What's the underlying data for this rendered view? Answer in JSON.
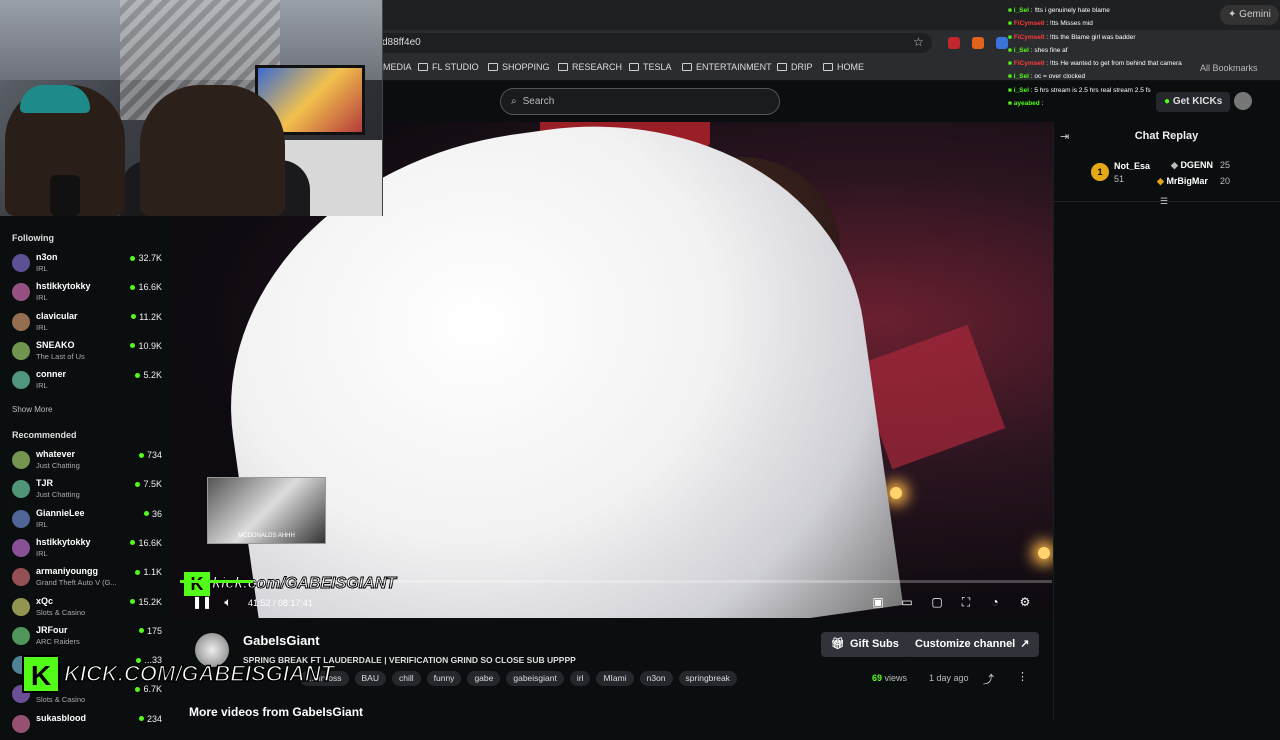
{
  "browser": {
    "url": "d88ff4e0",
    "gemini_label": "Gemini",
    "all_bookmarks_label": "All Bookmarks",
    "bookmarks": [
      "MEDIA",
      "FL STUDIO",
      "SHOPPING",
      "RESEARCH",
      "TESLA",
      "ENTERTAINMENT",
      "DRIP",
      "HOME"
    ]
  },
  "header": {
    "search_placeholder": "Search",
    "get_kicks_label": "Get KICKs"
  },
  "sidebar": {
    "following_heading": "Following",
    "following": [
      {
        "name": "n3on",
        "category": "IRL",
        "viewers": "32.7K"
      },
      {
        "name": "hstikkytokky",
        "category": "IRL",
        "viewers": "16.6K"
      },
      {
        "name": "clavicular",
        "category": "IRL",
        "viewers": "11.2K"
      },
      {
        "name": "SNEAKO",
        "category": "The Last of Us",
        "viewers": "10.9K"
      },
      {
        "name": "conner",
        "category": "IRL",
        "viewers": "5.2K"
      }
    ],
    "show_more": "Show More",
    "recommended_heading": "Recommended",
    "recommended": [
      {
        "name": "whatever",
        "category": "Just Chatting",
        "viewers": "734"
      },
      {
        "name": "TJR",
        "category": "Just Chatting",
        "viewers": "7.5K"
      },
      {
        "name": "GiannieLee",
        "category": "IRL",
        "viewers": "36"
      },
      {
        "name": "hstikkytokky",
        "category": "IRL",
        "viewers": "16.6K"
      },
      {
        "name": "armaniyoungg",
        "category": "Grand Theft Auto V (G...",
        "viewers": "1.1K"
      },
      {
        "name": "xQc",
        "category": "Slots & Casino",
        "viewers": "15.2K"
      },
      {
        "name": "JRFour",
        "category": "ARC Raiders",
        "viewers": "175"
      },
      {
        "name": "...",
        "category": "",
        "viewers": "...33"
      },
      {
        "name": "...ot",
        "category": "Slots & Casino",
        "viewers": "6.7K"
      },
      {
        "name": "sukasblood",
        "category": "",
        "viewers": "234"
      }
    ]
  },
  "chat_overlay": [
    {
      "user": "i_Sel",
      "user_color": "#53fc18",
      "text": ": !tts i genuinely hate blame"
    },
    {
      "user": "FiCymsell",
      "user_color": "#ff3b3b",
      "text": ": !tts Misses mid"
    },
    {
      "user": "FiCymsell",
      "user_color": "#ff3b3b",
      "text": ": !tts the Blame girl was badder"
    },
    {
      "user": "i_Sel",
      "user_color": "#53fc18",
      "text": ": shes fine af"
    },
    {
      "user": "FiCymsell",
      "user_color": "#ff3b3b",
      "text": ": !tts He wanted to get from behind that camera"
    },
    {
      "user": "i_Sel",
      "user_color": "#53fc18",
      "text": ": oc = over clocked"
    },
    {
      "user": "i_Sel",
      "user_color": "#53fc18",
      "text": ": 5 hrs stream is 2.5 hrs real stream 2.5 fs"
    },
    {
      "user": "ayeabed",
      "user_color": "#53fc18",
      "text": ":"
    }
  ],
  "player": {
    "time": "41:52 / 08:17:41",
    "progress_fraction": 0.084,
    "thumb_caption": "MCDONALDS AHHH",
    "watermark": "kick.com/GABEISGIANT"
  },
  "chat_panel": {
    "title": "Chat Replay",
    "leaders": [
      {
        "rank": "1",
        "name": "Not_Esa",
        "count": "51",
        "color": "#e4a817"
      },
      {
        "rank": "",
        "name": "DGENN",
        "count": "25",
        "color": "#ffffff"
      },
      {
        "rank": "",
        "name": "MrBigMar",
        "count": "20",
        "color": "#e4a817"
      }
    ]
  },
  "channel": {
    "name": "GabeIsGiant",
    "title": "SPRING BREAK FT LAUDERDALE | VERIFICATION GRIND SO CLOSE SUB UPPPP",
    "tags": [
      "...dinross",
      "BAU",
      "chill",
      "funny",
      "gabe",
      "gabeisgiant",
      "irl",
      "MIami",
      "n3on",
      "springbreak"
    ],
    "gift_subs_label": "Gift Subs",
    "customize_label": "Customize channel",
    "views_count": "69",
    "views_label": "views",
    "ago": "1 day ago",
    "more_videos": "More videos from GabeIsGiant"
  },
  "big_watermark": "KICK.COM/GABEISGIANT",
  "colors": {
    "accent": "#53fc18",
    "bg": "#0b0e0f",
    "medal": "#e4a817"
  }
}
